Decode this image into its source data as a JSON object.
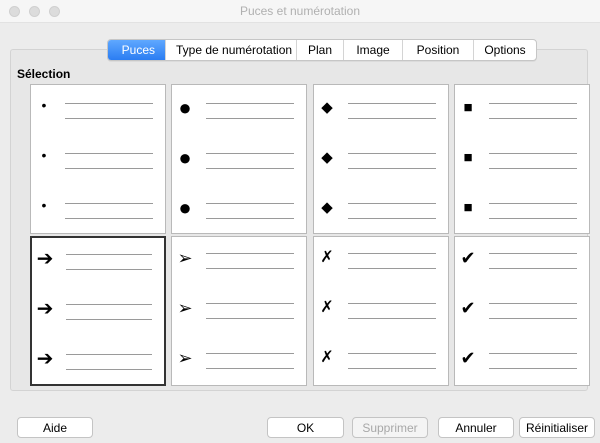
{
  "window": {
    "title": "Puces et numérotation"
  },
  "tabs": [
    {
      "label": "Puces",
      "active": true
    },
    {
      "label": "Type de numérotation"
    },
    {
      "label": "Plan"
    },
    {
      "label": "Image"
    },
    {
      "label": "Position"
    },
    {
      "label": "Options"
    }
  ],
  "selection_label": "Sélection",
  "bullets": [
    {
      "name": "small-dot-bullet",
      "glyph": "•"
    },
    {
      "name": "large-dot-bullet",
      "glyph": "●"
    },
    {
      "name": "diamond-bullet",
      "glyph": "◆"
    },
    {
      "name": "square-bullet",
      "glyph": "■"
    },
    {
      "name": "arrow-bullet",
      "glyph": "➔"
    },
    {
      "name": "arrowhead-bullet",
      "glyph": "➢"
    },
    {
      "name": "cross-bullet",
      "glyph": "✗"
    },
    {
      "name": "checkmark-bullet",
      "glyph": "✔"
    }
  ],
  "selected_index": 4,
  "buttons": {
    "help": "Aide",
    "ok": "OK",
    "delete": "Supprimer",
    "cancel": "Annuler",
    "reset": "Réinitialiser"
  }
}
